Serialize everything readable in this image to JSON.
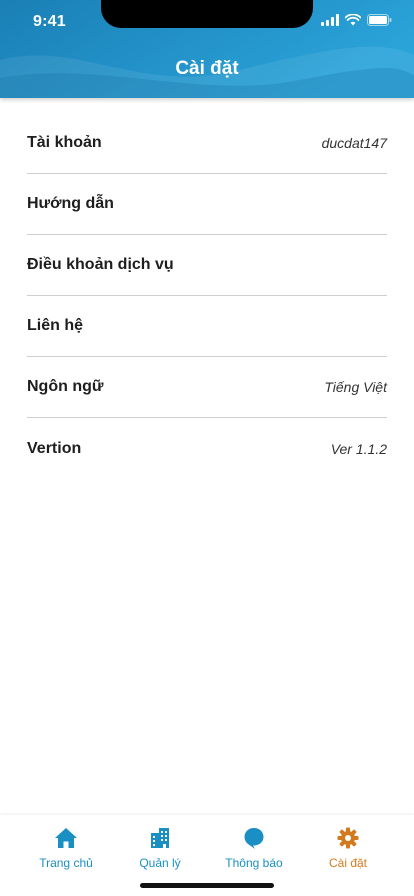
{
  "status_bar": {
    "time": "9:41"
  },
  "header": {
    "title": "Cài đặt"
  },
  "settings": [
    {
      "label": "Tài khoản",
      "value": "ducdat147"
    },
    {
      "label": "Hướng dẫn",
      "value": ""
    },
    {
      "label": "Điều khoản dịch vụ",
      "value": ""
    },
    {
      "label": "Liên hệ",
      "value": ""
    },
    {
      "label": "Ngôn ngữ",
      "value": "Tiếng Việt"
    },
    {
      "label": "Vertion",
      "value": "Ver 1.1.2"
    }
  ],
  "bottom_nav": [
    {
      "label": "Trang chủ",
      "icon": "home-icon"
    },
    {
      "label": "Quản lý",
      "icon": "buildings-icon"
    },
    {
      "label": "Thông báo",
      "icon": "chat-bubble-icon"
    },
    {
      "label": "Cài đặt",
      "icon": "gear-icon",
      "active": true
    }
  ],
  "colors": {
    "header_gradient_start": "#1a7fb5",
    "header_gradient_end": "#2aa3d9",
    "nav_blue": "#1a8fc4",
    "nav_active": "#d47a1e"
  }
}
